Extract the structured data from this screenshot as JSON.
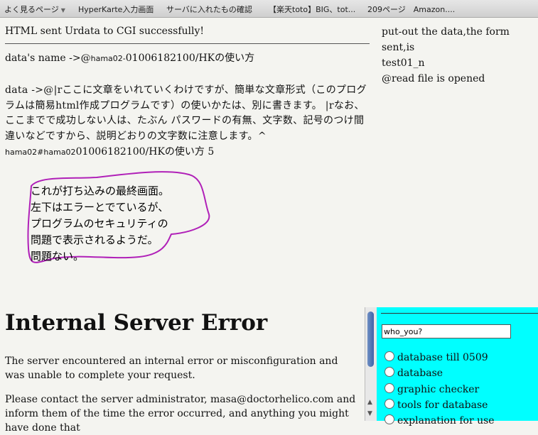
{
  "bookmarks": [
    {
      "label": "よく見るページ",
      "has_menu": true
    },
    {
      "label": "HyperKarte入力画面"
    },
    {
      "label": "サーバに入れたもの確認"
    },
    {
      "label": "【楽天toto】BIG、tot..."
    },
    {
      "label": "209ページ　Amazon...."
    }
  ],
  "main": {
    "status": "HTML sent Urdata to CGI successfully!",
    "data_name_label": "data's name ->@",
    "data_name_id": "hama02-",
    "data_name_value": "01006182100/HKの使い方",
    "data_label": "data ->@|rここに文章をいれていくわけですが、簡単な文章形式（このプログラムは簡易html作成プログラムです）の使いかたは、別に書きます。 |rなお、ここまでで成功しない人は、たぶん パスワードの有無、文字数、記号のつけ間違いなどですから、説明どおりの文字数に注意します。^",
    "footer_prefix_1": "hama02",
    "footer_hash": "#",
    "footer_prefix_2": "hama02",
    "footer_value": "01006182100/HKの使い方 5"
  },
  "right": {
    "put_out_line1": "put-out the data,the form sent,is",
    "put_out_line2": "test01_n",
    "read_file": "@read file is opened"
  },
  "annotation": {
    "line1": "これが打ち込みの最終画面。",
    "line2": "左下はエラーとでているが、",
    "line3": "プログラムのセキュリティの",
    "line4": "問題で表示されるようだ。",
    "line5": "問題ない。",
    "stroke_color": "#b020b8"
  },
  "error": {
    "heading": "Internal Server Error",
    "p1": "The server encountered an internal error or misconfiguration and was unable to complete your request.",
    "p2": "Please contact the server administrator, masa@doctorhelico.com and inform them of the time the error occurred, and anything you might have done that"
  },
  "panel": {
    "bg_color": "#00ffff",
    "input_value": "who_you?",
    "options": [
      "database till 0509",
      "database",
      "graphic checker",
      "tools for database",
      "explanation for use"
    ]
  }
}
